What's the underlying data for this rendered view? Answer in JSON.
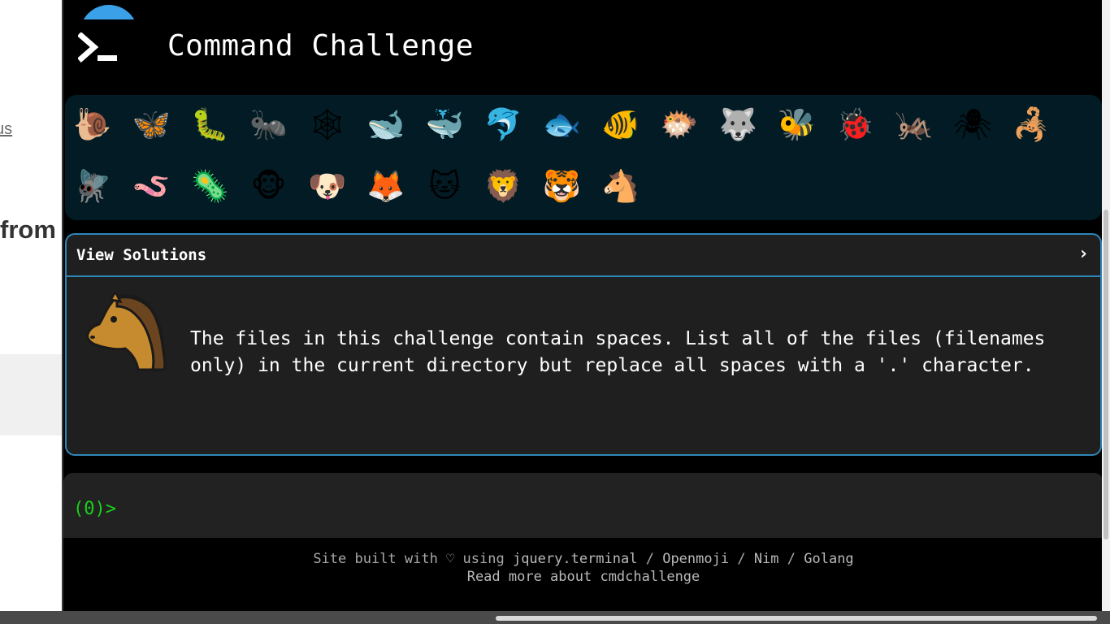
{
  "background_page": {
    "link_text": "us",
    "heading_text": "from"
  },
  "header": {
    "title": "Command Challenge",
    "logo_icon": "terminal-prompt-icon"
  },
  "animals": [
    {
      "name": "snail",
      "glyph": "🐌"
    },
    {
      "name": "butterfly",
      "glyph": "🦋"
    },
    {
      "name": "caterpillar",
      "glyph": "🐛"
    },
    {
      "name": "ant",
      "glyph": "🐜"
    },
    {
      "name": "spider-web",
      "glyph": "🕸"
    },
    {
      "name": "whale",
      "glyph": "🐋"
    },
    {
      "name": "spouting-whale",
      "glyph": "🐳"
    },
    {
      "name": "dolphin",
      "glyph": "🐬"
    },
    {
      "name": "fish",
      "glyph": "🐟"
    },
    {
      "name": "tropical-fish",
      "glyph": "🐠"
    },
    {
      "name": "blowfish",
      "glyph": "🐡"
    },
    {
      "name": "wolf",
      "glyph": "🐺"
    },
    {
      "name": "bee",
      "glyph": "🐝"
    },
    {
      "name": "ladybug",
      "glyph": "🐞"
    },
    {
      "name": "cricket",
      "glyph": "🦗"
    },
    {
      "name": "spider",
      "glyph": "🕷"
    },
    {
      "name": "scorpion",
      "glyph": "🦂"
    },
    {
      "name": "fly",
      "glyph": "🪰"
    },
    {
      "name": "worm",
      "glyph": "🪱"
    },
    {
      "name": "microbe",
      "glyph": "🦠"
    },
    {
      "name": "monkey",
      "glyph": "🐵"
    },
    {
      "name": "dog",
      "glyph": "🐶"
    },
    {
      "name": "fox",
      "glyph": "🦊"
    },
    {
      "name": "cat",
      "glyph": "🐱"
    },
    {
      "name": "lion",
      "glyph": "🦁"
    },
    {
      "name": "tiger",
      "glyph": "🐯"
    },
    {
      "name": "horse",
      "glyph": "🐴"
    }
  ],
  "solutions": {
    "title": "View Solutions",
    "chevron": "›",
    "challenge_icon": "horse-icon",
    "description": "The files in this challenge contain spaces. List all of the files (filenames only) in the current directory but replace all spaces with a '.' character."
  },
  "terminal": {
    "prompt_open": "(",
    "counter": "0",
    "prompt_close": ")>"
  },
  "footer": {
    "prefix": "Site built with ♡ using ",
    "links": [
      "jquery.terminal",
      "Openmoji",
      "Nim",
      "Golang"
    ],
    "separator": " / ",
    "read_more": "Read more about cmdchallenge"
  },
  "colors": {
    "background": "#000000",
    "panel": "#021b24",
    "accent": "#2e86b8",
    "prompt": "#19d119"
  }
}
